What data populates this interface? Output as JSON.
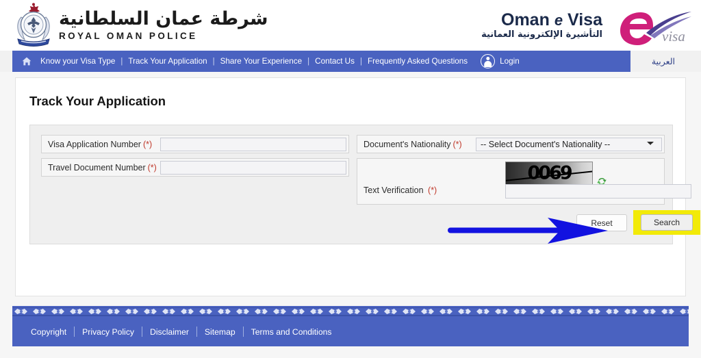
{
  "header": {
    "police_arabic": "شرطة عمان السلطانية",
    "police_english": "ROYAL OMAN POLICE",
    "crest_icon": "royal-oman-police-crest",
    "evisa_word1": "Oman",
    "evisa_word2": "e",
    "evisa_word3": "Visa",
    "evisa_arabic": "التأشيرة الإلكترونية العمانية",
    "evisa_mark_icon": "evisa-e-swoosh-logo"
  },
  "nav": {
    "home_icon": "home-icon",
    "items": [
      {
        "label": "Know your Visa Type"
      },
      {
        "label": "Track Your Application"
      },
      {
        "label": "Share Your Experience"
      },
      {
        "label": "Contact Us"
      },
      {
        "label": "Frequently Asked Questions"
      }
    ],
    "separator": "|",
    "login_label": "Login",
    "login_icon": "user-avatar-icon",
    "arabic_label": "العربية",
    "bar_color": "#4a62c0"
  },
  "main": {
    "title": "Track Your Application",
    "fields": {
      "visa_application_number": {
        "label": "Visa Application Number",
        "required_mark": "(*)",
        "value": "",
        "placeholder": ""
      },
      "travel_document_number": {
        "label": "Travel Document Number",
        "required_mark": "(*)",
        "value": "",
        "placeholder": ""
      },
      "documents_nationality": {
        "label": "Document's Nationality",
        "required_mark": "(*)",
        "selected": "-- Select Document's Nationality --",
        "options": [
          "-- Select Document's Nationality --"
        ]
      },
      "text_verification": {
        "label": "Text Verification",
        "required_mark": "(*)",
        "value": "",
        "placeholder": ""
      }
    },
    "captcha": {
      "code": "0069",
      "refresh_icon": "refresh-captcha-icon"
    },
    "buttons": {
      "reset_label": "Reset",
      "search_label": "Search"
    }
  },
  "annotation": {
    "arrow_icon": "blue-pointer-arrow",
    "arrow_color": "#1212e0",
    "highlight_color": "#f2ea08",
    "highlight_target": "Search"
  },
  "footer": {
    "links": [
      {
        "label": "Copyright"
      },
      {
        "label": "Privacy Policy"
      },
      {
        "label": "Disclaimer"
      },
      {
        "label": "Sitemap"
      },
      {
        "label": "Terms and Conditions"
      }
    ],
    "ornament_icon": "decorative-border-pattern",
    "bar_color": "#4a62c0"
  }
}
